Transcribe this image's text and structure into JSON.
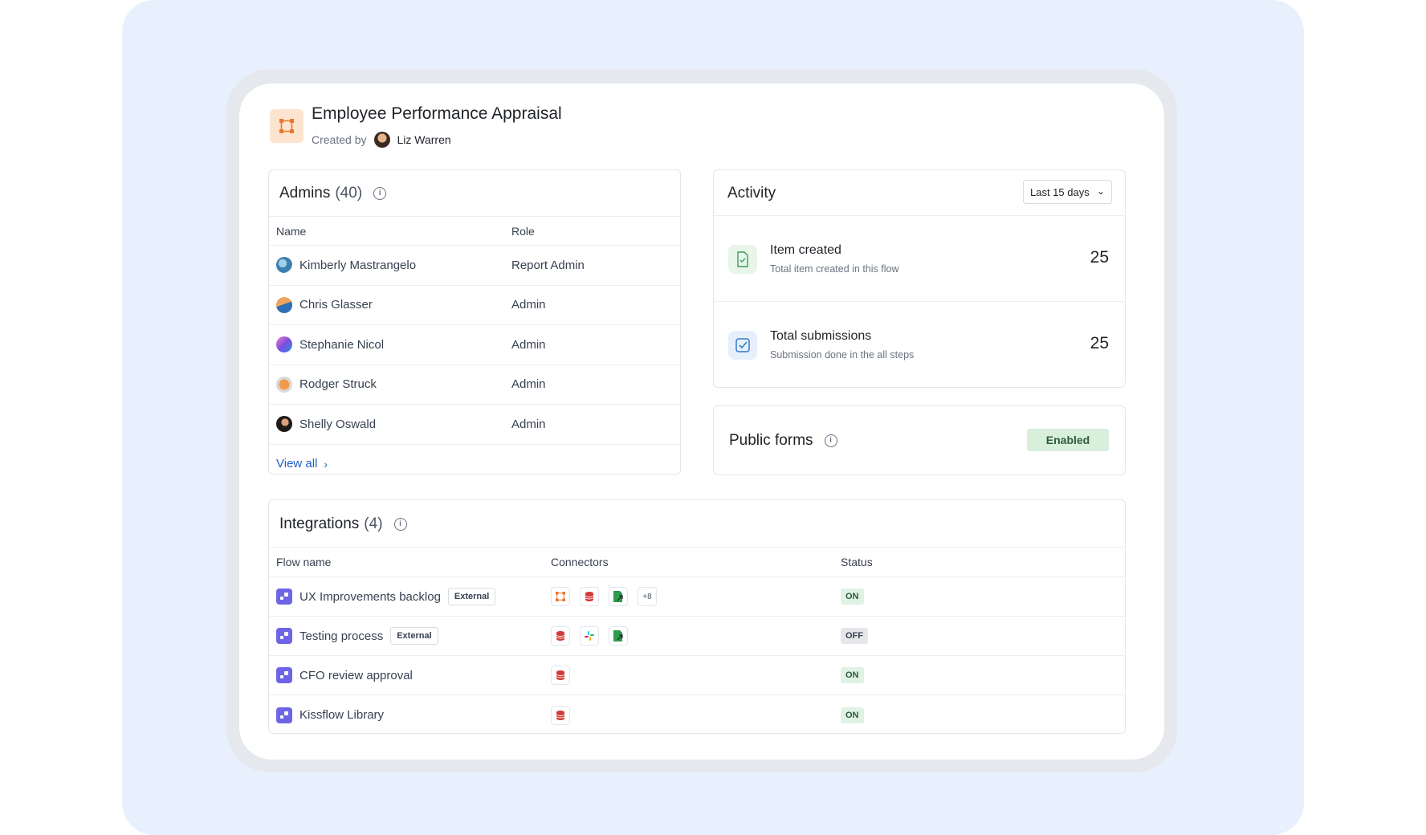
{
  "header": {
    "title": "Employee Performance Appraisal",
    "created_by_label": "Created by",
    "creator": "Liz Warren"
  },
  "admins": {
    "title": "Admins",
    "count": "(40)",
    "columns": [
      "Name",
      "Role"
    ],
    "rows": [
      {
        "name": "Kimberly Mastrangelo",
        "role": "Report Admin"
      },
      {
        "name": "Chris Glasser",
        "role": "Admin"
      },
      {
        "name": "Stephanie Nicol",
        "role": "Admin"
      },
      {
        "name": "Rodger Struck",
        "role": "Admin"
      },
      {
        "name": "Shelly Oswald",
        "role": "Admin"
      }
    ],
    "view_all": "View all"
  },
  "activity": {
    "title": "Activity",
    "range": "Last 15 days",
    "items": [
      {
        "title": "Item created",
        "subtitle": "Total item created in this flow",
        "value": "25"
      },
      {
        "title": "Total submissions",
        "subtitle": "Submission done in the all steps",
        "value": "25"
      }
    ]
  },
  "public_forms": {
    "title": "Public forms",
    "status": "Enabled"
  },
  "integrations": {
    "title": "Integrations",
    "count": "(4)",
    "columns": [
      "Flow name",
      "Connectors",
      "Status"
    ],
    "rows": [
      {
        "name": "UX Improvements backlog",
        "tag": "External",
        "connectors": [
          "flow-connector-icon",
          "database-icon",
          "sheet-export-icon"
        ],
        "more": "+8",
        "status": "ON"
      },
      {
        "name": "Testing process",
        "tag": "External",
        "connectors": [
          "database-icon",
          "slack-icon",
          "sheet-export-icon"
        ],
        "status": "OFF"
      },
      {
        "name": "CFO review approval",
        "connectors": [
          "database-icon"
        ],
        "status": "ON"
      },
      {
        "name": "Kissflow Library",
        "connectors": [
          "database-icon"
        ],
        "status": "ON"
      }
    ]
  },
  "colors": {
    "background_panel": "#e8f0fd",
    "link": "#1d5fc4",
    "enabled_badge": "#d8efdc",
    "flow_icon": "#6e64e6"
  }
}
